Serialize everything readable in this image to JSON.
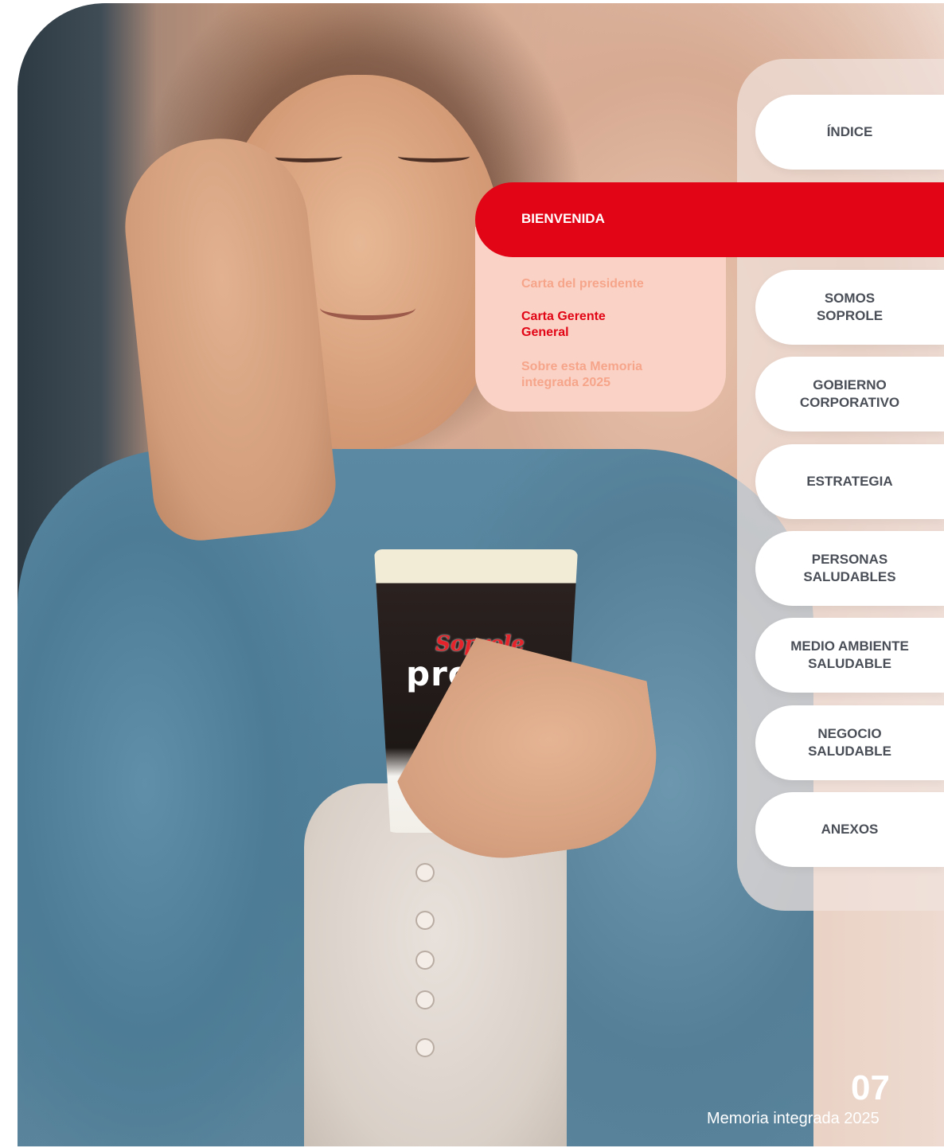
{
  "nav": {
    "indice": "ÍNDICE",
    "active_section": "BIENVENIDA",
    "submenu": [
      {
        "label": "Carta del presidente",
        "current": false
      },
      {
        "label": "Carta Gerente\nGeneral",
        "current": true
      },
      {
        "label": "Sobre esta Memoria\nintegrada 2025",
        "current": false
      }
    ],
    "sections": [
      "SOMOS\nSOPROLE",
      "GOBIERNO\nCORPORATIVO",
      "ESTRATEGIA",
      "PERSONAS\nSALUDABLES",
      "MEDIO AMBIENTE\nSALUDABLE",
      "NEGOCIO\nSALUDABLE",
      "ANEXOS"
    ]
  },
  "photo": {
    "brand": "Soprole",
    "product": "prote"
  },
  "footer": {
    "page_number": "07",
    "title": "Memoria integrada 2025"
  },
  "colors": {
    "accent": "#e10515",
    "submenu_bg": "#fad3c6",
    "submenu_text": "#f6a58b",
    "nav_text": "#4a4f57"
  }
}
